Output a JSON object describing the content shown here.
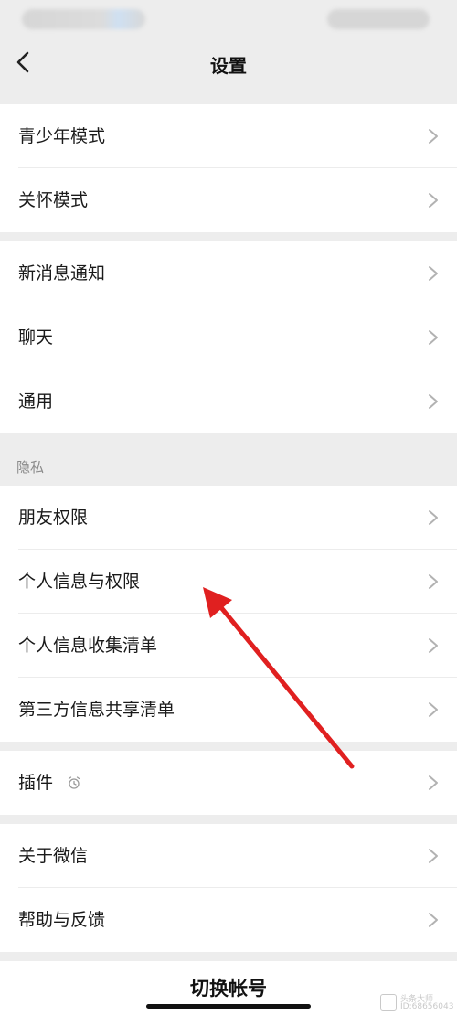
{
  "nav": {
    "title": "设置"
  },
  "groups": [
    {
      "items": [
        "青少年模式",
        "关怀模式"
      ]
    },
    {
      "items": [
        "新消息通知",
        "聊天",
        "通用"
      ]
    },
    {
      "header": "隐私",
      "items": [
        "朋友权限",
        "个人信息与权限",
        "个人信息收集清单",
        "第三方信息共享清单"
      ]
    },
    {
      "items": [
        "插件"
      ]
    },
    {
      "items": [
        "关于微信",
        "帮助与反馈"
      ]
    }
  ],
  "bottom": {
    "switch_account": "切换帐号"
  },
  "annotation": {
    "arrow_color": "#e02020"
  },
  "watermark": {
    "line1": "头条大师",
    "line2": "ID:68656043"
  },
  "colors": {
    "background": "#ededed",
    "card": "#ffffff",
    "text": "#1a1a1a",
    "secondary": "#8a8a8a"
  }
}
